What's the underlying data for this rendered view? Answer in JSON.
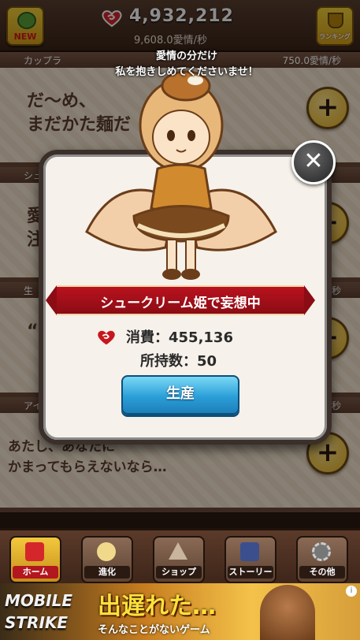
{
  "header": {
    "new_label": "NEW",
    "total_love": "4,932,212",
    "rate": "9,608.0愛情/秒",
    "ranking_label": "ランキング"
  },
  "cards": [
    {
      "name": "カップラ",
      "rate": "750.0愛情/秒",
      "text_lines": [
        "だ〜め、",
        "まだかた麺だ"
      ]
    },
    {
      "name": "シュ",
      "rate": "",
      "text_lines": [
        "愛情",
        "注"
      ]
    },
    {
      "name": "生",
      "rate": "秒",
      "text_lines": [
        "“責"
      ]
    },
    {
      "name": "アイ",
      "rate": "/秒",
      "text_lines": [
        "あたし、あなたに",
        "かまってもらえないなら…"
      ]
    }
  ],
  "popup": {
    "speech": "愛情の分だけ\n私を抱きしめてくださいませ！",
    "title": "シュークリーム姫で妄想中",
    "cost": "消費：455,136",
    "owned": "所持数：50",
    "produce_label": "生産",
    "close_symbol": "✕"
  },
  "nav": [
    {
      "label": "ホーム",
      "icon": "home-icon",
      "active": true
    },
    {
      "label": "進化",
      "icon": "evolve-icon",
      "active": false
    },
    {
      "label": "ショップ",
      "icon": "shop-icon",
      "active": false
    },
    {
      "label": "ストーリー",
      "icon": "story-icon",
      "active": false
    },
    {
      "label": "その他",
      "icon": "gear-icon",
      "active": false
    }
  ],
  "ad": {
    "brand_line1": "MOBILE",
    "brand_line2": "STRIKE",
    "headline": "出遅れた…",
    "sub": "そんなことがないゲーム",
    "info": "i"
  },
  "colors": {
    "ribbon": "#b9121e",
    "produce": "#2b9fd8",
    "accent": "#f2c83c"
  }
}
